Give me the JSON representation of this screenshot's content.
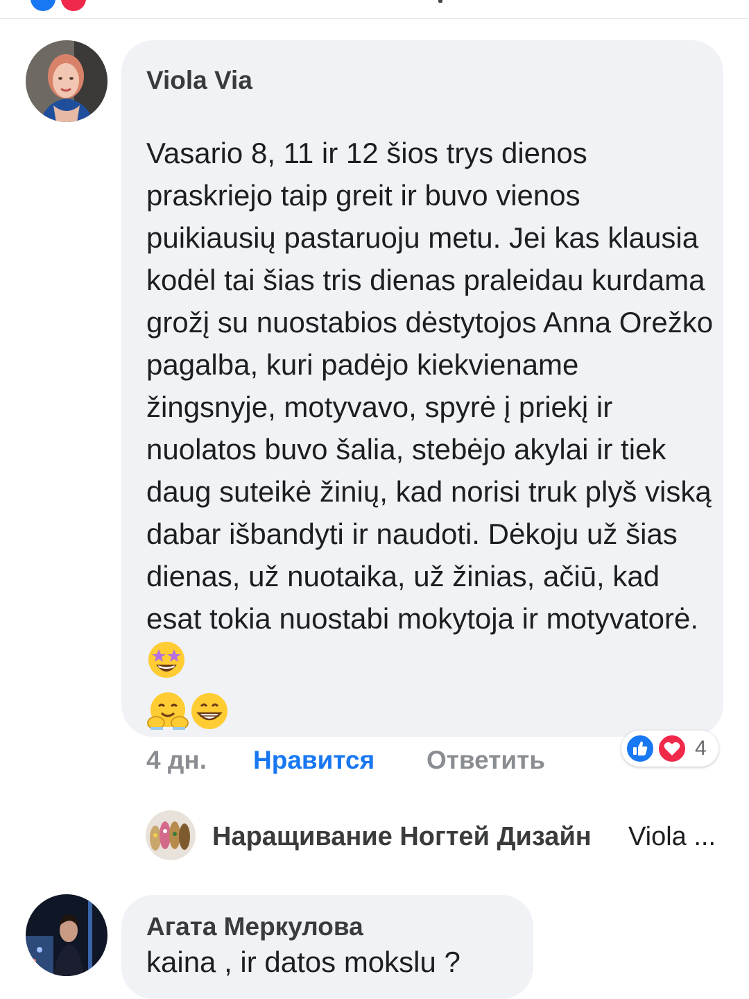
{
  "comments": [
    {
      "author": "Viola Via",
      "text": "Vasario 8, 11 ir 12 šios trys dienos praskriejo taip greit ir buvo vienos puikiausių pastaruoju metu. Jei kas klausia kodėl tai šias tris dienas praleidau kurdama grožį su nuostabios dėstytojos Anna Orežko pagalba, kuri padėjo kiekviename žingsnyje, motyvavo, spyrė į priekį ir nuolatos buvo šalia, stebėjo akylai ir tiek daug suteikė žinių, kad norisi truk plyš viską dabar išbandyti ir naudoti. Dėkoju už šias dienas, už nuotaika, už žinias, ačiū, kad esat tokia nuostabi mokytoja ir motyvatorė.",
      "emojis": [
        "star-struck-icon",
        "hugging-face-icon",
        "grinning-face-icon"
      ],
      "time": "4 дн.",
      "like_label": "Нравится",
      "reply_label": "Ответить",
      "reaction_icons": [
        "like-icon",
        "love-icon"
      ],
      "reaction_count": "4",
      "reply_preview": {
        "author": "Наращивание Ногтей Дизайн",
        "snippet": "Viola ..."
      }
    },
    {
      "author": "Агата Меркулова",
      "text": "kaina , ir datos mokslu ?"
    }
  ],
  "colors": {
    "bubble": "#f0f2f5",
    "like_blue": "#1877f2",
    "love_red": "#f02849",
    "meta_gray": "#8a8d91"
  }
}
